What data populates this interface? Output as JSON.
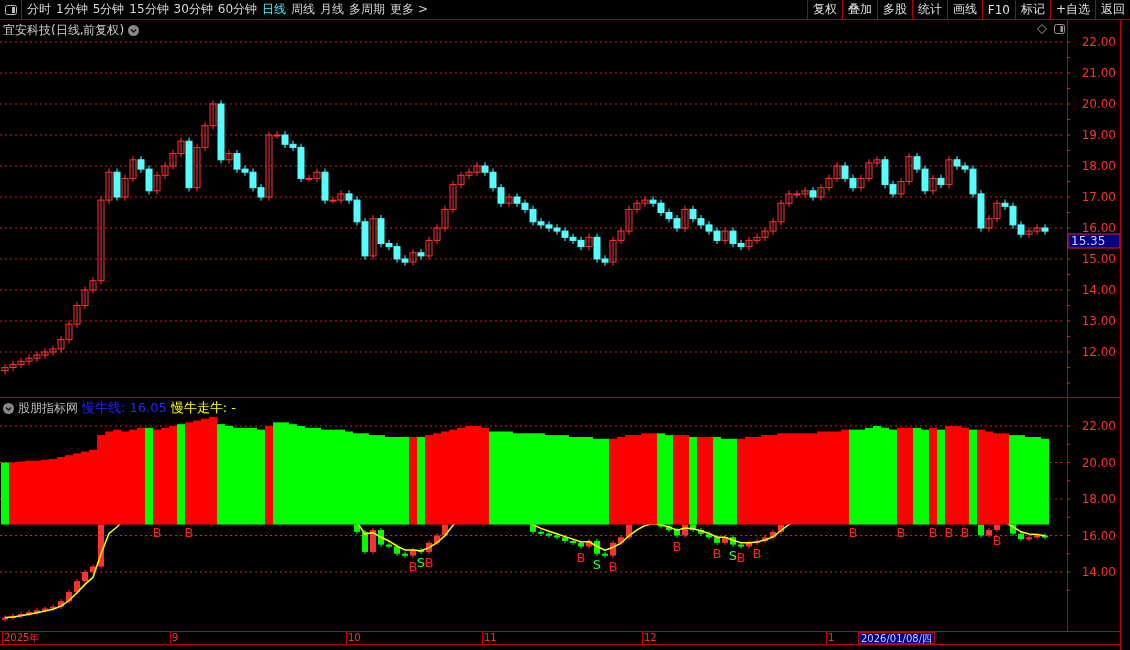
{
  "toolbar": {
    "periods": [
      {
        "label": "分时",
        "selected": false
      },
      {
        "label": "1分钟",
        "selected": false
      },
      {
        "label": "5分钟",
        "selected": false
      },
      {
        "label": "15分钟",
        "selected": false
      },
      {
        "label": "30分钟",
        "selected": false
      },
      {
        "label": "60分钟",
        "selected": false
      },
      {
        "label": "日线",
        "selected": true
      },
      {
        "label": "周线",
        "selected": false
      },
      {
        "label": "月线",
        "selected": false
      },
      {
        "label": "多周期",
        "selected": false
      },
      {
        "label": "更多 >",
        "selected": false
      }
    ],
    "buttons": [
      "复权",
      "叠加",
      "多股",
      "统计",
      "画线",
      "F10",
      "标记",
      "+自选",
      "返回"
    ]
  },
  "price_chart": {
    "title": "宜安科技(日线,前复权)",
    "last_price": "15.35",
    "axis_labels": [
      "22.00",
      "21.00",
      "20.00",
      "19.00",
      "18.00",
      "17.00",
      "16.00",
      "15.00",
      "14.00",
      "13.00",
      "12.00"
    ]
  },
  "indicator": {
    "name": "股朋指标网",
    "legend": [
      {
        "text": "慢牛线: 16.05",
        "color": "#2626ff"
      },
      {
        "text": "慢牛走牛: -",
        "color": "#ffff00"
      }
    ],
    "axis_labels": [
      "22.00",
      "20.00",
      "18.00",
      "16.00",
      "14.00"
    ],
    "signals": [
      {
        "text": "B",
        "color": "#ff2020"
      },
      {
        "text": "B",
        "color": "#ff2020"
      },
      {
        "text": "B",
        "color": "#ff2020"
      },
      {
        "text": "S",
        "color": "#30ff30"
      },
      {
        "text": "B",
        "color": "#ff2020"
      },
      {
        "text": "B",
        "color": "#ff2020"
      },
      {
        "text": "S",
        "color": "#30ff30"
      },
      {
        "text": "B",
        "color": "#ff2020"
      },
      {
        "text": "B",
        "color": "#ff2020"
      },
      {
        "text": "B",
        "color": "#ff2020"
      },
      {
        "text": "S",
        "color": "#30ff30"
      },
      {
        "text": "B",
        "color": "#ff2020"
      },
      {
        "text": "B",
        "color": "#ff2020"
      },
      {
        "text": "B",
        "color": "#ff2020"
      },
      {
        "text": "B",
        "color": "#ff2020"
      },
      {
        "text": "B",
        "color": "#ff2020"
      },
      {
        "text": "B",
        "color": "#ff2020"
      },
      {
        "text": "B",
        "color": "#ff2020"
      },
      {
        "text": "B",
        "color": "#ff2020"
      }
    ]
  },
  "time_axis": {
    "labels": [
      "2025年",
      "9",
      "10",
      "11",
      "12",
      "1"
    ],
    "cursor_date": "2026/01/08/四"
  }
}
